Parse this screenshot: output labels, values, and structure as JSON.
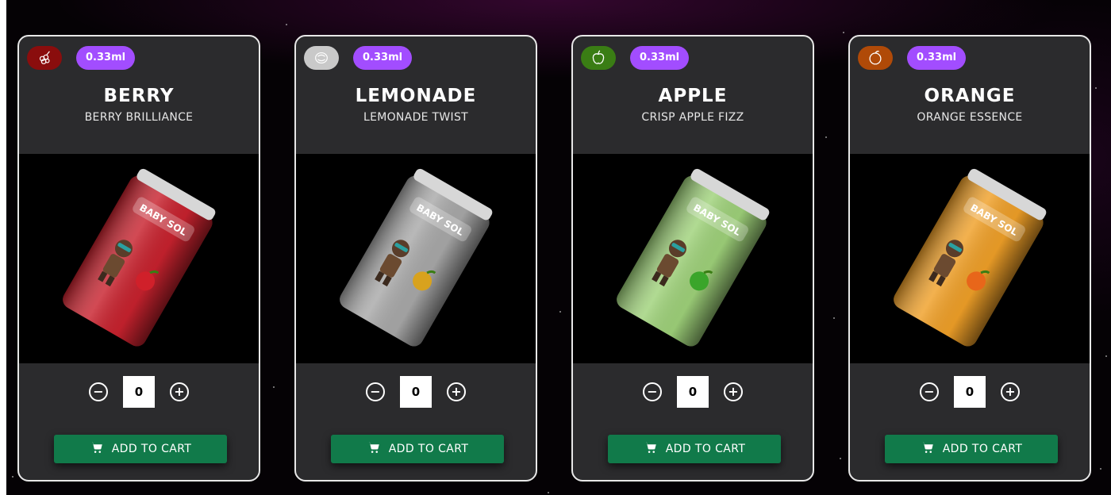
{
  "products": [
    {
      "flavor": "BERRY",
      "subtitle": "BERRY BRILLIANCE",
      "size": "0.33ml",
      "icon": "berry-icon",
      "icon_bg": "#8a0d0d",
      "can_color": "#c8222e",
      "fruit_color": "#d0202a",
      "quantity": "0",
      "add_label": "ADD TO CART",
      "can_brand": "BABY SOL"
    },
    {
      "flavor": "LEMONADE",
      "subtitle": "LEMONADE TWIST",
      "size": "0.33ml",
      "icon": "lemon-icon",
      "icon_bg": "#c9c9c9",
      "can_color": "#a9a9a9",
      "fruit_color": "#d8a21e",
      "quantity": "0",
      "add_label": "ADD TO CART",
      "can_brand": "BABY SOL"
    },
    {
      "flavor": "APPLE",
      "subtitle": "CRISP APPLE FIZZ",
      "size": "0.33ml",
      "icon": "apple-icon",
      "icon_bg": "#3a7d14",
      "can_color": "#9fd27a",
      "fruit_color": "#3aa52a",
      "quantity": "0",
      "add_label": "ADD TO CART",
      "can_brand": "BABY SOL"
    },
    {
      "flavor": "ORANGE",
      "subtitle": "ORANGE ESSENCE",
      "size": "0.33ml",
      "icon": "orange-icon",
      "icon_bg": "#b04a08",
      "can_color": "#f0a028",
      "fruit_color": "#e8661a",
      "quantity": "0",
      "add_label": "ADD TO CART",
      "can_brand": "BABY SOL"
    }
  ],
  "colors": {
    "badge": "#a24dff",
    "cart_button": "#117a4a",
    "card_bg": "#2b2b2d"
  }
}
